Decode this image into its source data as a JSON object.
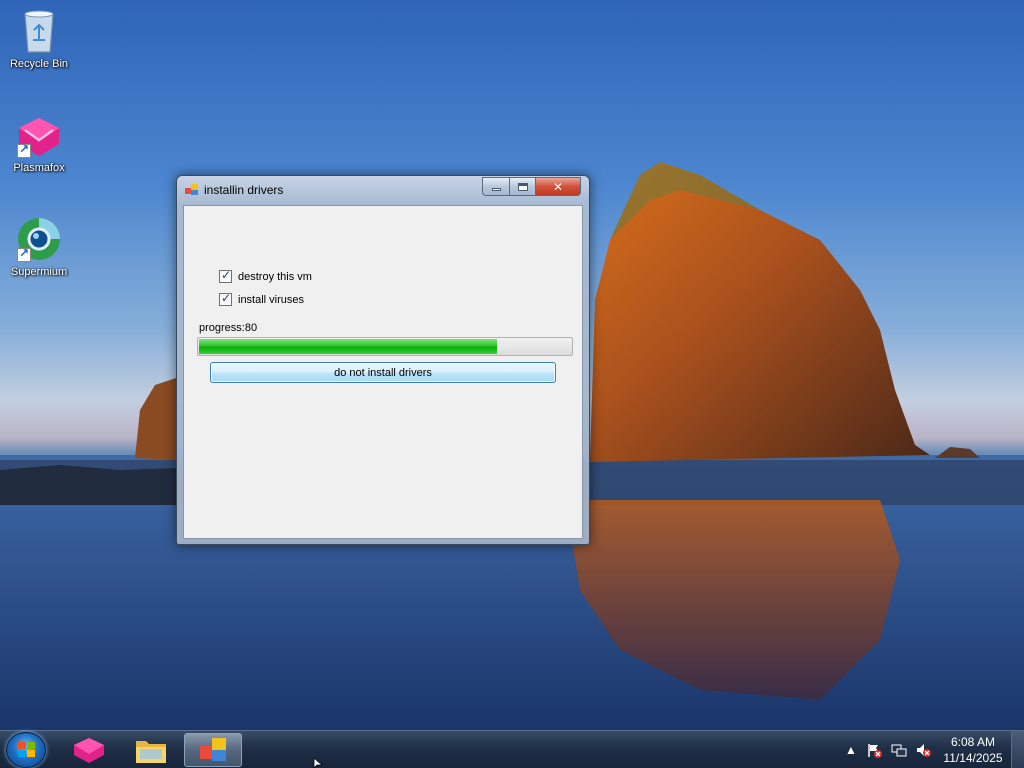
{
  "desktop": {
    "icons": [
      {
        "label": "Recycle Bin",
        "icon": "recycle-bin-icon"
      },
      {
        "label": "Plasmafox",
        "icon": "plasmafox-icon"
      },
      {
        "label": "Supermium",
        "icon": "supermium-icon"
      }
    ]
  },
  "window": {
    "title": "installin drivers",
    "controls": {
      "minimize": "minimize-icon",
      "maximize": "maximize-icon",
      "close": "✕"
    },
    "checkboxes": [
      {
        "label": "destroy this vm",
        "checked": true
      },
      {
        "label": "install viruses",
        "checked": true
      }
    ],
    "progress_label": "progress:80",
    "progress_value": 80,
    "progress_max": 100,
    "button_label": "do not install drivers"
  },
  "taskbar": {
    "start": "start-button",
    "pinned": [
      {
        "name": "plasmafox",
        "icon": "plasmafox-icon"
      },
      {
        "name": "file-explorer",
        "icon": "folder-icon"
      },
      {
        "name": "installer-app",
        "icon": "app-window-icon",
        "active": true
      }
    ],
    "tray": {
      "icons": [
        "show-hidden-icons-arrow",
        "action-center-flag-icon",
        "network-icon",
        "volume-muted-icon"
      ],
      "time": "6:08 AM",
      "date": "11/14/2025"
    }
  },
  "colors": {
    "progress_green": "#06b006",
    "close_red": "#c03a20",
    "taskbar": "#1f2f47"
  }
}
